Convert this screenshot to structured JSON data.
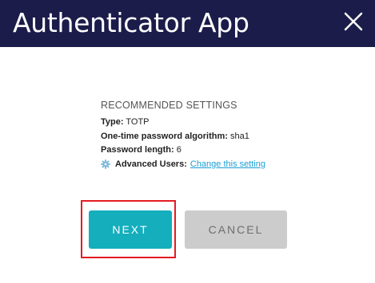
{
  "header": {
    "title": "Authenticator App",
    "close_icon": "close-icon"
  },
  "settings": {
    "heading": "RECOMMENDED SETTINGS",
    "type_label": "Type:",
    "type_value": "TOTP",
    "algorithm_label": "One-time password algorithm:",
    "algorithm_value": "sha1",
    "length_label": "Password length:",
    "length_value": "6",
    "advanced_icon": "gear-icon",
    "advanced_label": "Advanced Users:",
    "advanced_link": "Change this setting"
  },
  "actions": {
    "next_label": "NEXT",
    "cancel_label": "CANCEL"
  },
  "colors": {
    "header_bg": "#1b1c4a",
    "primary": "#14aebd",
    "secondary": "#cccccc",
    "link": "#1a9fd6",
    "highlight": "#e41b23"
  }
}
